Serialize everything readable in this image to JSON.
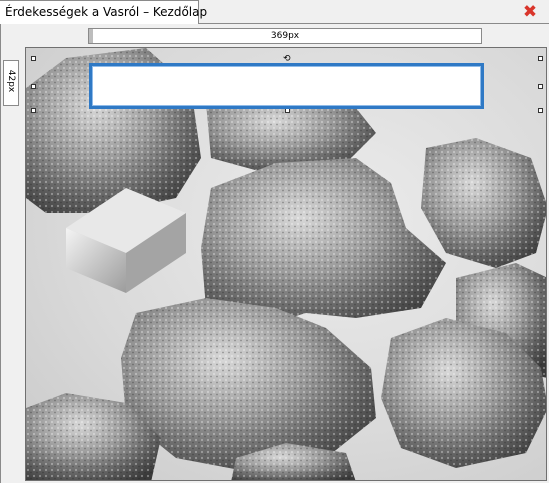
{
  "tab": {
    "title": "Érdekességek a Vasról – Kezdőlap"
  },
  "window": {
    "close_glyph": "✖",
    "close_icon": "close-icon"
  },
  "rulers": {
    "width_label": "369px",
    "height_label": "42px"
  },
  "slide": {
    "textbox_value": "",
    "background_image": "iron-nuggets-photo"
  },
  "colors": {
    "selection": "#2f79c5",
    "close": "#d9352b"
  }
}
